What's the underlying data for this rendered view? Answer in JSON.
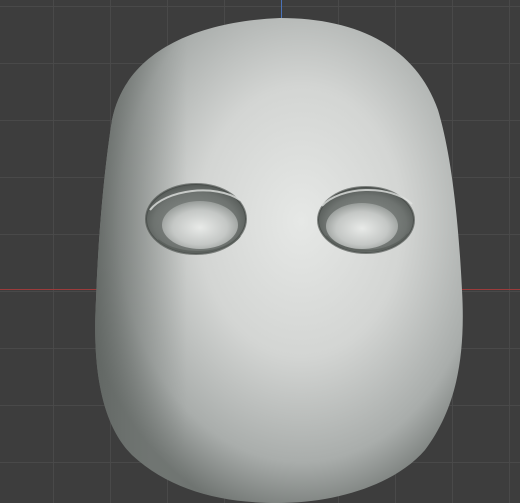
{
  "viewport": {
    "background_color": "#3d3d3d",
    "grid_color": "#4a4a4a",
    "x_axis_color": "#9c3b3b",
    "y_axis_color": "#4a72b8"
  },
  "model": {
    "object": "sculpted-head-mesh",
    "surface_color": "#c9cbc9",
    "features": [
      "left-eye-socket",
      "right-eye-socket"
    ]
  }
}
